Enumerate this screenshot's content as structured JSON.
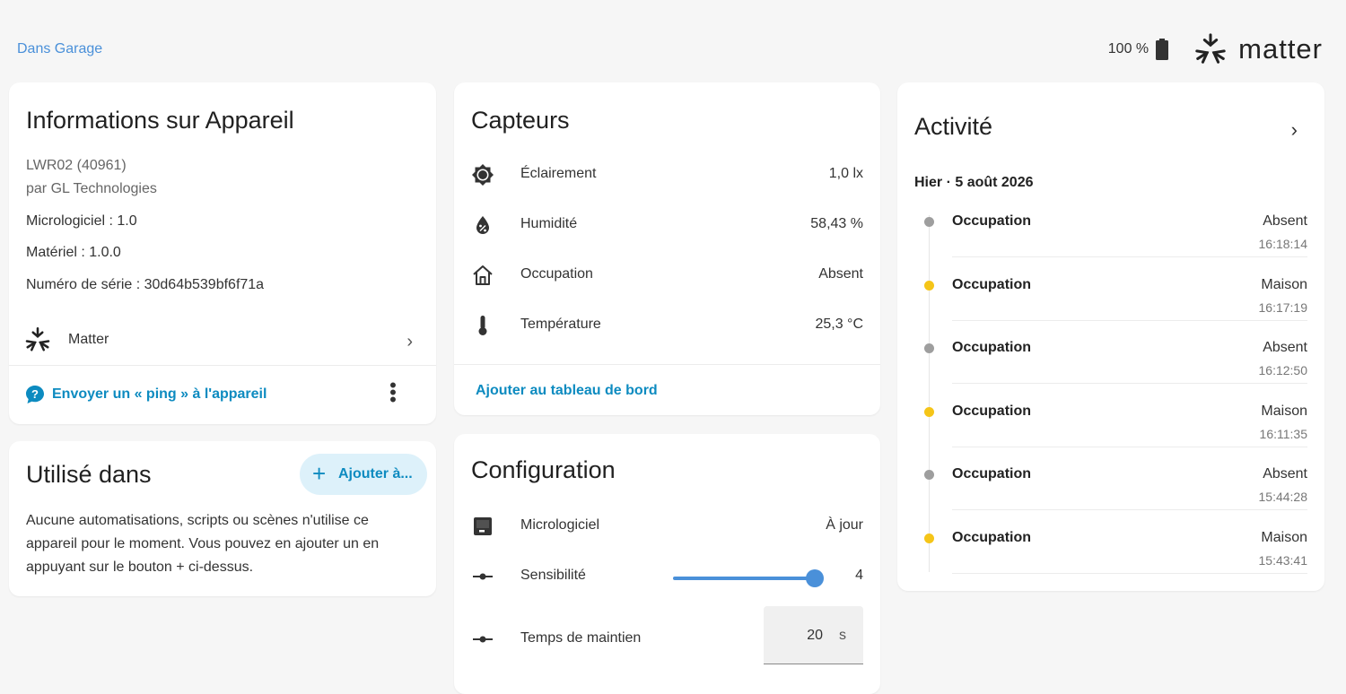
{
  "breadcrumb": {
    "area": "Dans Garage"
  },
  "header": {
    "battery": "100 %",
    "brand": "matter"
  },
  "device_info": {
    "title": "Informations sur Appareil",
    "model": "LWR02 (40961)",
    "manufacturer": "par GL Technologies",
    "firmware": "Micrologiciel : 1.0",
    "hardware": "Matériel : 1.0.0",
    "serial": "Numéro de série : 30d64b539bf6f71a",
    "integration": "Matter",
    "ping_label": "Envoyer un « ping » à l'appareil"
  },
  "used_in": {
    "title": "Utilisé dans",
    "add_label": "Ajouter à...",
    "empty_text": "Aucune automatisations, scripts ou scènes n'utilise ce appareil pour le moment. Vous pouvez en ajouter un en appuyant sur le bouton + ci-dessus."
  },
  "sensors": {
    "title": "Capteurs",
    "items": [
      {
        "label": "Éclairement",
        "value": "1,0 lx",
        "icon": "brightness-icon"
      },
      {
        "label": "Humidité",
        "value": "58,43 %",
        "icon": "water-percent-icon"
      },
      {
        "label": "Occupation",
        "value": "Absent",
        "icon": "home-outline-icon"
      },
      {
        "label": "Température",
        "value": "25,3 °C",
        "icon": "thermometer-icon"
      }
    ],
    "add_dashboard": "Ajouter au tableau de bord"
  },
  "configuration": {
    "title": "Configuration",
    "firmware_label": "Micrologiciel",
    "firmware_value": "À jour",
    "sensitivity_label": "Sensibilité",
    "sensitivity_value": "4",
    "sensitivity_fraction": 1.0,
    "hold_label": "Temps de maintien",
    "hold_value": "20",
    "hold_unit": "s"
  },
  "activity": {
    "title": "Activité",
    "date": "Hier · 5 août 2026",
    "events": [
      {
        "name": "Occupation",
        "state": "Absent",
        "time": "16:18:14",
        "color": "#9e9e9e"
      },
      {
        "name": "Occupation",
        "state": "Maison",
        "time": "16:17:19",
        "color": "#f5c518"
      },
      {
        "name": "Occupation",
        "state": "Absent",
        "time": "16:12:50",
        "color": "#9e9e9e"
      },
      {
        "name": "Occupation",
        "state": "Maison",
        "time": "16:11:35",
        "color": "#f5c518"
      },
      {
        "name": "Occupation",
        "state": "Absent",
        "time": "15:44:28",
        "color": "#9e9e9e"
      },
      {
        "name": "Occupation",
        "state": "Maison",
        "time": "15:43:41",
        "color": "#f5c518"
      }
    ]
  },
  "colors": {
    "accent": "#0d8bc0",
    "slider": "#4a90d9",
    "absent": "#9e9e9e",
    "home": "#f5c518"
  }
}
